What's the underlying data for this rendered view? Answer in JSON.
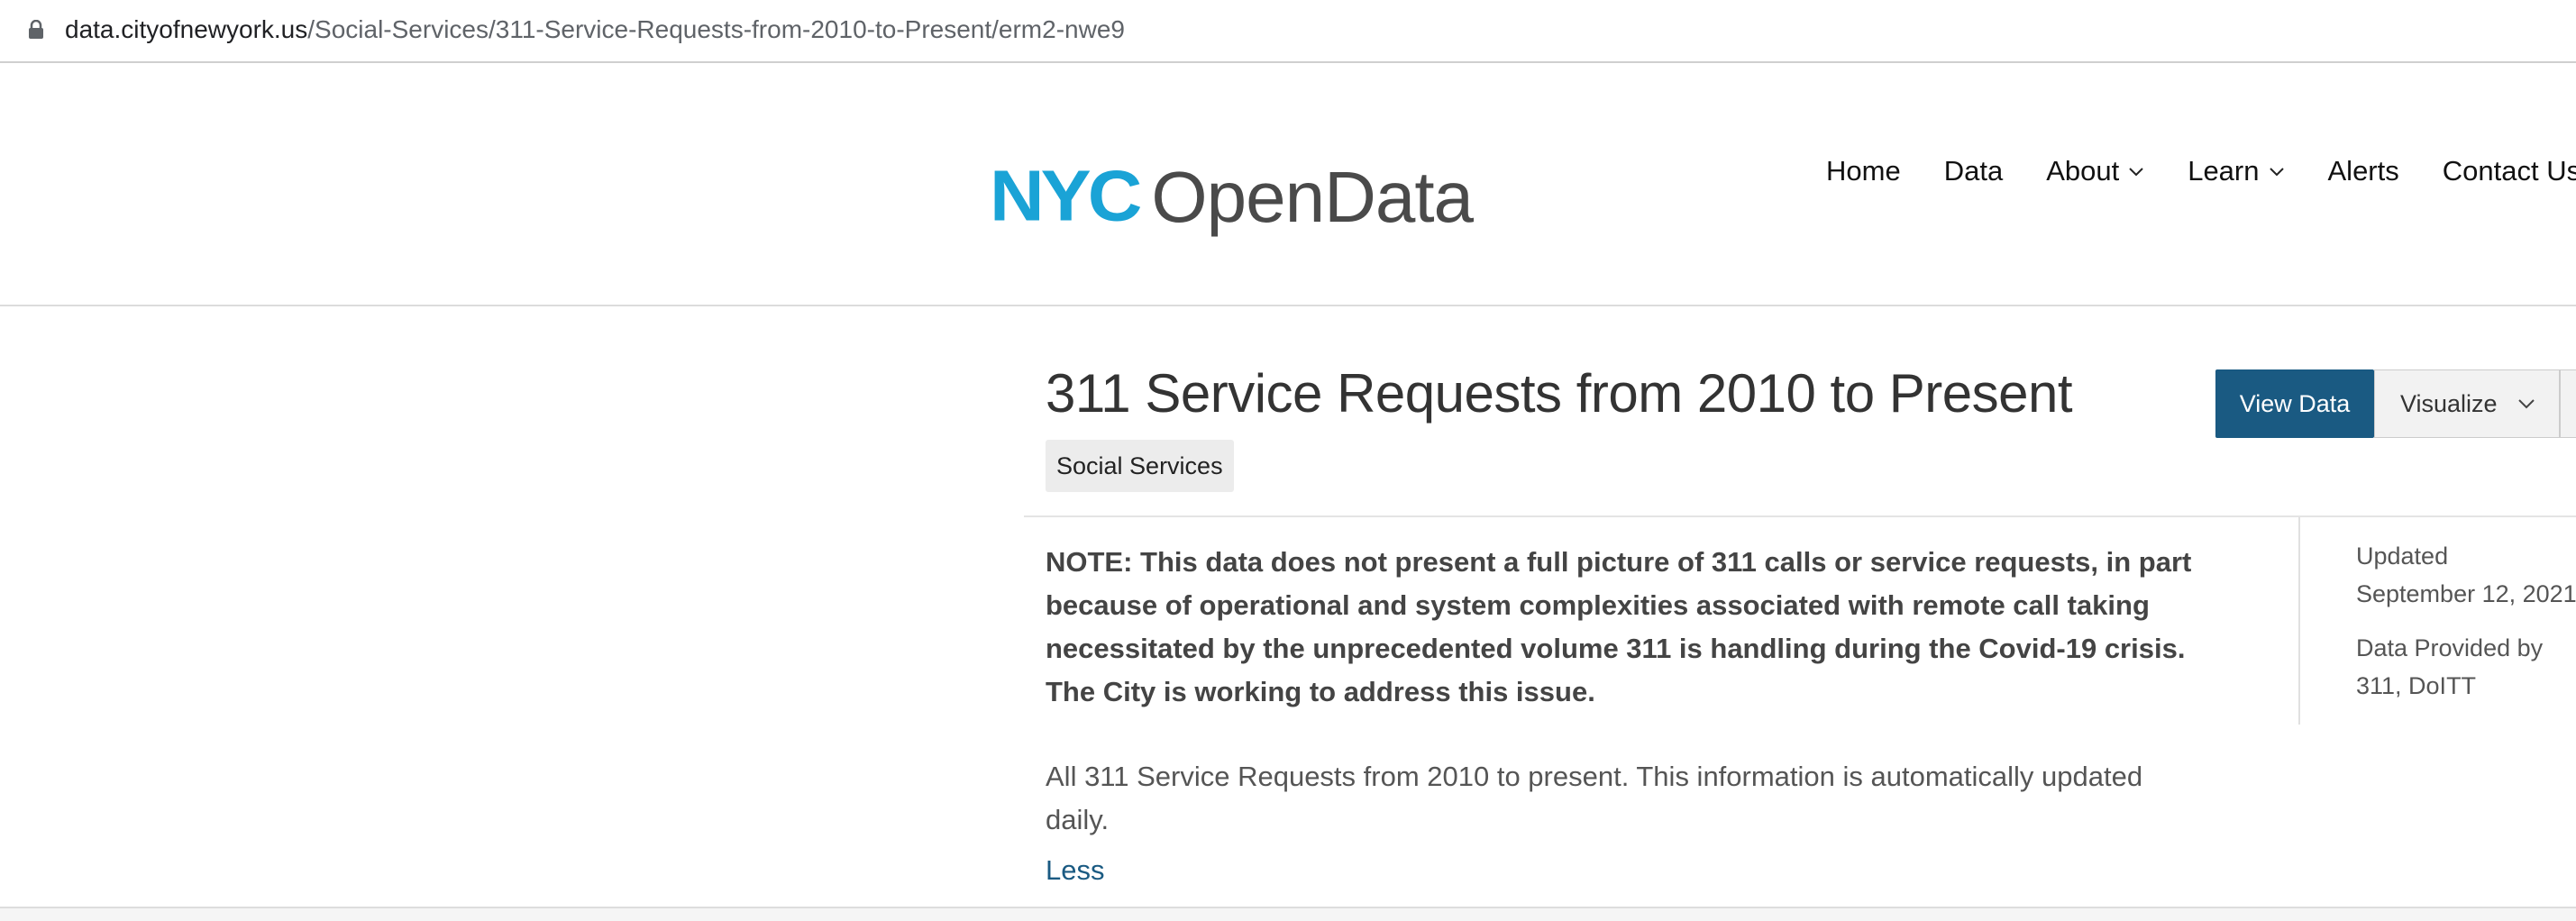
{
  "browser": {
    "url_host": "data.cityofnewyork.us",
    "url_path": "/Social-Services/311-Service-Requests-from-2010-to-Present/erm2-nwe9"
  },
  "header": {
    "logo_nyc": "NYC",
    "logo_opendata": "OpenData",
    "nav": [
      {
        "label": "Home"
      },
      {
        "label": "Data"
      },
      {
        "label": "About"
      },
      {
        "label": "Learn"
      },
      {
        "label": "Alerts"
      },
      {
        "label": "Contact Us"
      }
    ]
  },
  "dataset": {
    "title": "311 Service Requests from 2010 to Present",
    "category": "Social Services",
    "view_data_label": "View Data",
    "visualize_label": "Visualize",
    "note": "NOTE: This data does not present a full picture of 311 calls or service requests, in part because of operational and system complexities associated with remote call taking necessitated by the unprecedented volume 311 is handling during the Covid-19 crisis. The City is working to address this issue.",
    "description": "All 311 Service Requests from 2010 to present. This information is automatically updated daily.",
    "less_label": "Less",
    "meta": {
      "updated_label": "Updated",
      "updated_value": "September 12, 2021",
      "provided_label": "Data Provided by",
      "provided_value": "311, DoITT"
    }
  },
  "colors": {
    "brand_blue": "#1aa3d6",
    "button_primary": "#1a5a82",
    "link": "#1a5a82"
  }
}
